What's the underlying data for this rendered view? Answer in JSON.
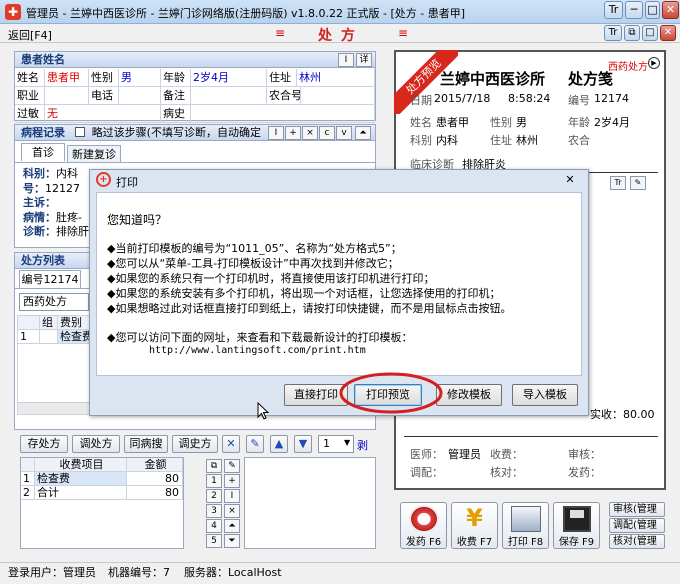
{
  "window": {
    "title": "管理员 - 兰婷中西医诊所 - 兰婷门诊网络版(注册码版) v1.8.0.22 正式版 - [处方 - 患者甲]",
    "minimize": "─",
    "maximize": "□",
    "close": "✕"
  },
  "toolbar": {
    "back": "返回[F4]",
    "heading": "处 方",
    "deco_left": "≡",
    "deco_right": "≡"
  },
  "patient": {
    "section": "患者姓名",
    "name_label": "姓名",
    "name": "患者甲",
    "gender_label": "性别",
    "gender": "男",
    "age_label": "年龄",
    "age": "2岁4月",
    "address_label": "住址",
    "address": "林州",
    "job_label": "职业",
    "phone_label": "电话",
    "note_label": "备注",
    "rural_label": "农合号",
    "allergy_label": "过敏",
    "allergy": "无",
    "history_label": "病史",
    "btn_i": "I",
    "btn_copy": "详"
  },
  "record": {
    "section": "病程记录",
    "skip_label": "略过该步骤(不填写诊断，自动确定",
    "tab_first": "首诊",
    "tab_new": "新建复诊",
    "lines": [
      {
        "k": "科别：",
        "v": "内科"
      },
      {
        "k": "号：",
        "v": "12127"
      },
      {
        "k": "主诉：",
        "v": ""
      },
      {
        "k": "病情：",
        "v": "肚疼-"
      },
      {
        "k": "诊断：",
        "v": "排除肝"
      }
    ],
    "icons": [
      "I",
      "+",
      "×",
      "c",
      "v",
      "⏶"
    ]
  },
  "presc": {
    "section": "处方列表",
    "tab_no": "编号12174",
    "type_select": "西药处方",
    "cols": [
      "组",
      "费别"
    ],
    "row_no": "1",
    "row_group": "",
    "row_fee": "检查费"
  },
  "actions": {
    "save": "存处方",
    "adjust": "调处方",
    "same": "同病搜",
    "history": "调史方",
    "num": "1",
    "more": "剥"
  },
  "fees": {
    "col_item": "收费项目",
    "col_amount": "金额",
    "rows": [
      {
        "no": "1",
        "item": "检查费",
        "amount": "80"
      },
      {
        "no": "2",
        "item": "合计",
        "amount": "80"
      }
    ],
    "side": [
      "1",
      "2",
      "3",
      "4",
      "5"
    ],
    "side_right": [
      "+",
      "I",
      "×",
      "⏶",
      "⏷"
    ]
  },
  "status": {
    "user": "登录用户：管理员",
    "machine": "机器编号：7",
    "server": "服务器：LocalHost"
  },
  "rx": {
    "ribbon": "处方预览",
    "clinic": "兰婷中西医诊所",
    "form_title": "处方笺",
    "type_tag": "西药处方",
    "date_label": "日期",
    "date": "2015/7/18",
    "time": "8:58:24",
    "no_label": "编号",
    "no": "12174",
    "name_label": "姓名",
    "name": "患者甲",
    "gender_label": "性别",
    "gender": "男",
    "age_label": "年龄",
    "age": "2岁4月",
    "dept_label": "科别",
    "dept": "内科",
    "addr_label": "住址",
    "addr": "林州",
    "rural_label": "农合",
    "diag_label": "临床诊断",
    "diag": "排除肝炎",
    "paid": "实收：80.00",
    "doctor_label": "医师：",
    "doctor": "管理员",
    "charge_label": "收费：",
    "review_label": "审核：",
    "dispense_label": "调配：",
    "check_label": "核对：",
    "issue_label": "发药："
  },
  "rightbtns": {
    "send": "发药 F6",
    "charge": "收费 F7",
    "print": "打印 F8",
    "save": "保存 F9",
    "review": "审核(管理",
    "dispense": "调配(管理",
    "check": "核对(管理"
  },
  "dialog": {
    "title": "打印",
    "close": "✕",
    "question": "您知道吗？",
    "bullets": [
      "◆当前打印模板的编号为“1011_05”、名称为“处方格式5”；",
      "◆您可以从“菜单-工具-打印模板设计”中再次找到并修改它；",
      "◆如果您的系统只有一个打印机时，将直接使用该打印机进行打印；",
      "◆如果您的系统安装有多个打印机，将出现一个对话框，让您选择使用的打印机；",
      "◆如果想略过此对话框直接打印到纸上，请按打印快捷键，而不是用鼠标点击按钮。"
    ],
    "visit": "◆您可以访问下面的网址，来查看和下载最新设计的打印模板：",
    "url": "http://www.lantingsoft.com/print.htm",
    "btn_direct": "直接打印",
    "btn_preview": "打印预览",
    "btn_modify": "修改模板",
    "btn_import": "导入模板"
  },
  "colors": {
    "accent_red": "#e03020",
    "title_bg": "#c4daf2",
    "highlight": "#d42020"
  }
}
